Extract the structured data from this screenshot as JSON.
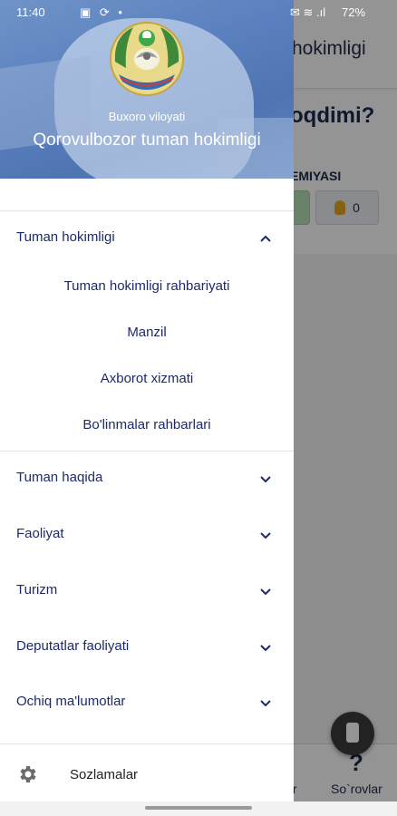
{
  "status_bar": {
    "time": "11:40",
    "icons_left": "▣ ⟳ •",
    "icons_right": "✉ ≋ .ıl",
    "battery": "72%"
  },
  "drawer": {
    "region": "Buxoro viloyati",
    "organization": "Qorovulbozor tuman hokimligi",
    "emblem_icon": "uzbekistan-emblem-icon",
    "menu": {
      "expanded": {
        "label": "Tuman hokimligi",
        "subitems": [
          "Tuman hokimligi rahbariyati",
          "Manzil",
          "Axborot xizmati",
          "Bo'linmalar rahbarlari"
        ]
      },
      "collapsed": [
        "Tuman haqida",
        "Faoliyat",
        "Turizm",
        "Deputatlar faoliyati",
        "Ochiq ma'lumotlar"
      ]
    },
    "settings_label": "Sozlamalar"
  },
  "background": {
    "title": "hokimligi",
    "question": "oqdimi?",
    "section": "EMIYASI",
    "vote_count": "0",
    "nav_label_left": "lar",
    "nav_label_right": "So`rovlar"
  },
  "colors": {
    "accent": "#1d2a6a",
    "header": "#5a80bf"
  }
}
